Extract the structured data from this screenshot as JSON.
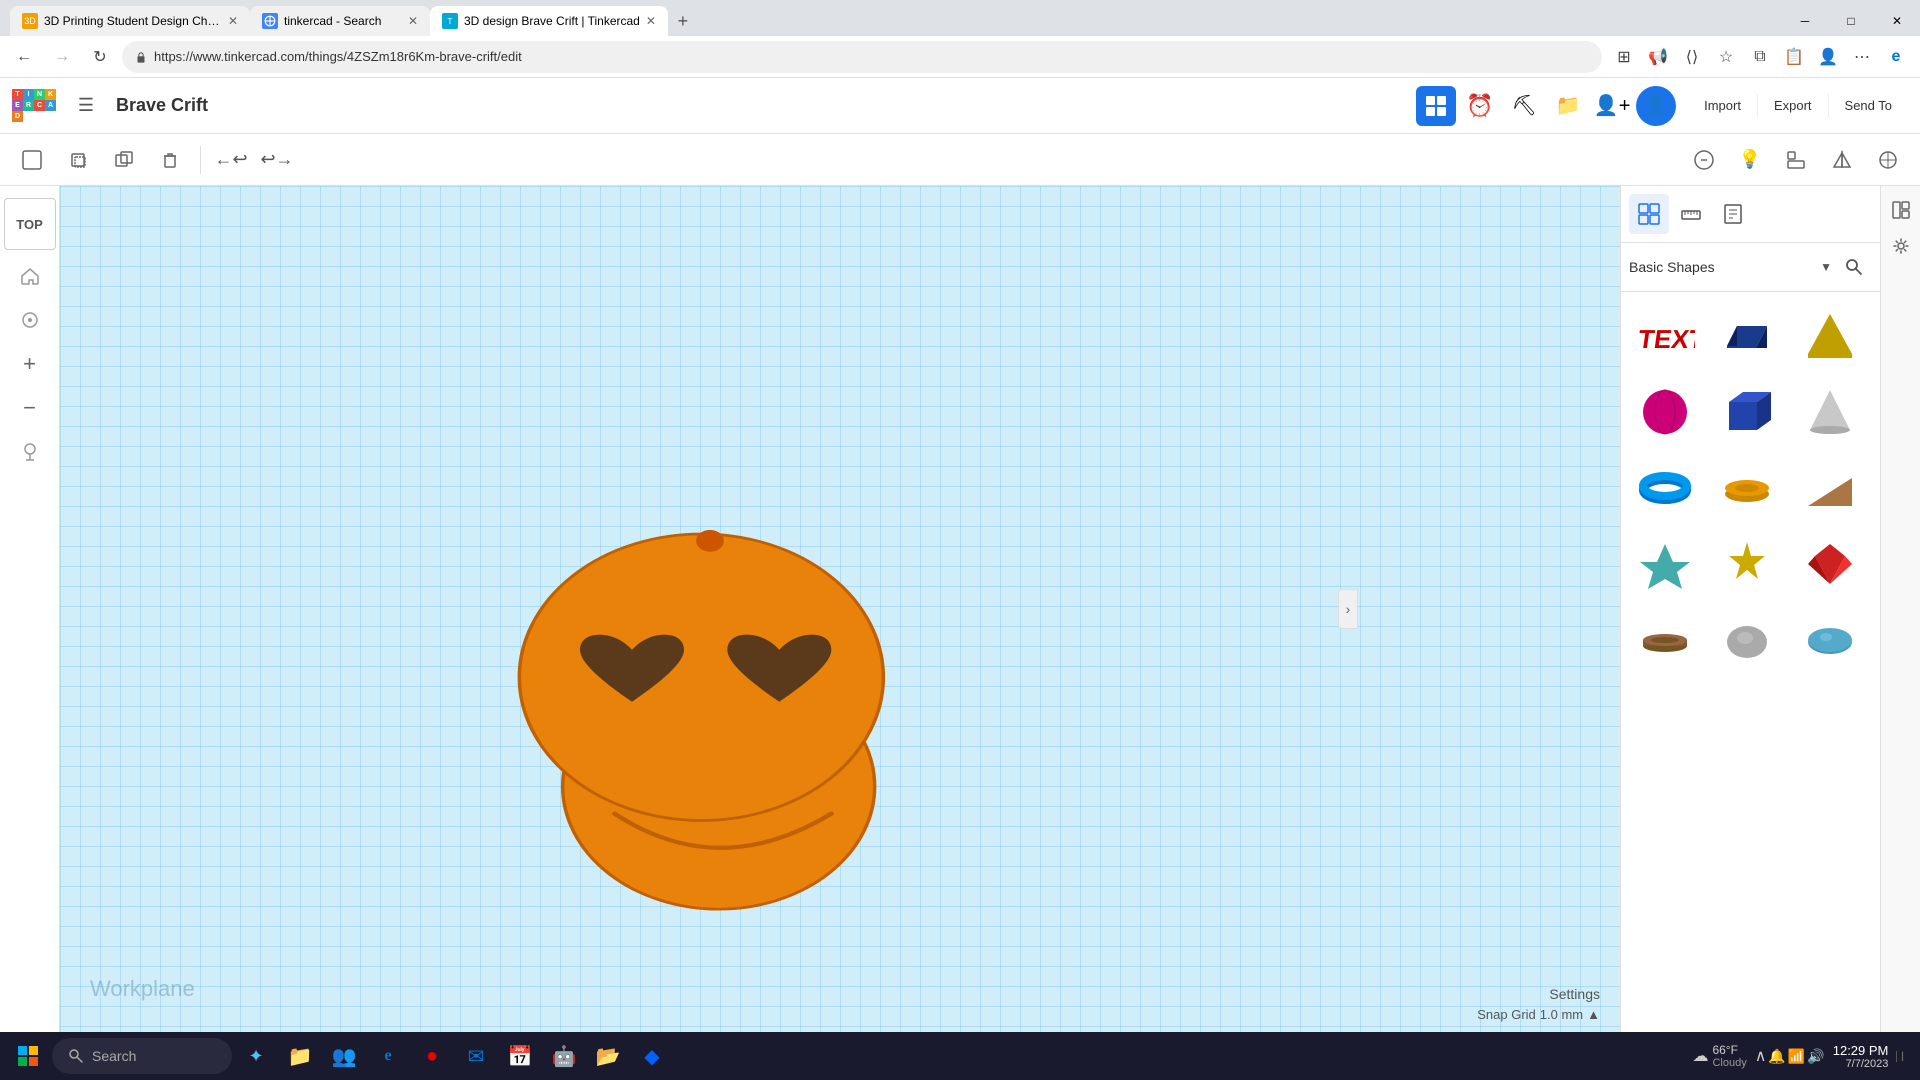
{
  "browser": {
    "tabs": [
      {
        "id": "tab1",
        "label": "3D Printing Student Design Chal...",
        "favicon_color": "#f0a000",
        "active": false
      },
      {
        "id": "tab2",
        "label": "tinkercad - Search",
        "favicon_color": "#4285f4",
        "active": false
      },
      {
        "id": "tab3",
        "label": "3D design Brave Crift | Tinkercad",
        "favicon_color": "#00a8d4",
        "active": true
      }
    ],
    "url": "https://www.tinkercad.com/things/4ZSZm18r6Km-brave-crift/edit",
    "window_controls": {
      "minimize": "─",
      "maximize": "□",
      "close": "✕"
    }
  },
  "app": {
    "logo": {
      "cells": [
        {
          "char": "T",
          "color": "#e74c3c"
        },
        {
          "char": "I",
          "color": "#3498db"
        },
        {
          "char": "N",
          "color": "#2ecc71"
        },
        {
          "char": "K",
          "color": "#e67e22"
        },
        {
          "char": "E",
          "color": "#9b59b6"
        },
        {
          "char": "R",
          "color": "#1abc9c"
        },
        {
          "char": "C",
          "color": "#e74c3c"
        },
        {
          "char": "A",
          "color": "#3498db"
        },
        {
          "char": "D",
          "color": "#f39c12"
        }
      ]
    },
    "design_name": "Brave Crift",
    "header_actions": {
      "import": "Import",
      "export": "Export",
      "send_to": "Send To"
    }
  },
  "toolbar": {
    "tools": [
      "new",
      "copy",
      "duplicate",
      "delete",
      "undo",
      "redo"
    ]
  },
  "view": {
    "label": "TOP"
  },
  "canvas": {
    "workplane_label": "Workplane",
    "settings_label": "Settings",
    "snap_grid_label": "Snap Grid",
    "snap_grid_value": "1.0 mm"
  },
  "right_panel": {
    "section_label": "Basic Shapes",
    "actions": {
      "import": "Import",
      "export": "Export",
      "send_to": "Send To"
    },
    "shapes": [
      {
        "name": "text-shape",
        "label": "Text",
        "color": "#cc0000"
      },
      {
        "name": "box-shape",
        "label": "Box",
        "color": "#1a3a8c"
      },
      {
        "name": "pyramid-shape",
        "label": "Pyramid",
        "color": "#e8c000"
      },
      {
        "name": "sphere-shape",
        "label": "Sphere",
        "color": "#cc0077"
      },
      {
        "name": "cube-shape",
        "label": "Cube",
        "color": "#2244aa"
      },
      {
        "name": "cone-shape",
        "label": "Cone",
        "color": "#aaaaaa"
      },
      {
        "name": "torus-shape",
        "label": "Torus",
        "color": "#0077cc"
      },
      {
        "name": "ring-shape",
        "label": "Ring",
        "color": "#cc7700"
      },
      {
        "name": "wedge-shape",
        "label": "Wedge",
        "color": "#996644"
      },
      {
        "name": "star1-shape",
        "label": "Star1",
        "color": "#44aaaa"
      },
      {
        "name": "star2-shape",
        "label": "Star2",
        "color": "#ccaa00"
      },
      {
        "name": "gem-shape",
        "label": "Gem",
        "color": "#cc2222"
      },
      {
        "name": "band-shape",
        "label": "Band",
        "color": "#885500"
      },
      {
        "name": "pebble-shape",
        "label": "Pebble",
        "color": "#999999"
      },
      {
        "name": "lens-shape",
        "label": "Lens",
        "color": "#4499bb"
      }
    ]
  },
  "taskbar": {
    "search_placeholder": "Search",
    "time": "12:29 PM",
    "date": "7/7/2023",
    "weather_temp": "66°F",
    "weather_condition": "Cloudy"
  }
}
